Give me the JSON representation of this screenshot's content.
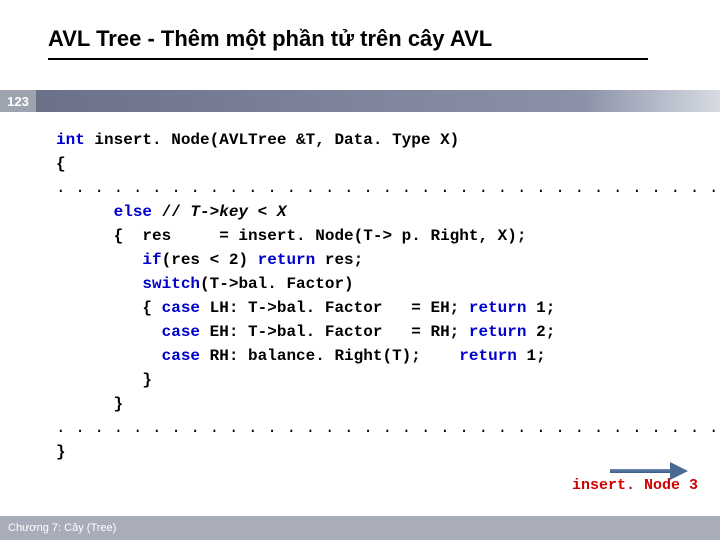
{
  "title": "AVL Tree - Thêm một phần tử trên cây AVL",
  "pageNumber": "123",
  "code": {
    "l1a": "int",
    "l1b": " insert. Node(AVLTree &T, Data. Type X)",
    "l2": "{",
    "l3": ". . . . . . . . . . . . . . . . . . . . . . . . . . . . . . . . . . . . . . . . . . . . . . . .",
    "l4a": "      ",
    "l4b": "else",
    "l4c": " // ",
    "l4d": "T->key < X",
    "l5a": "      {  res     = insert. Node(T-> p. Right, X);",
    "l6a": "         ",
    "l6b": "if",
    "l6c": "(res < 2) ",
    "l6d": "return",
    "l6e": " res;",
    "l7a": "         ",
    "l7b": "switch",
    "l7c": "(T->bal. Factor)",
    "l8a": "         { ",
    "l8b": "case",
    "l8c": " LH: T->bal. Factor   = EH; ",
    "l8d": "return",
    "l8e": " 1;",
    "l9a": "           ",
    "l9b": "case",
    "l9c": " EH: T->bal. Factor   = RH; ",
    "l9d": "return",
    "l9e": " 2;",
    "l10a": "           ",
    "l10b": "case",
    "l10c": " RH: balance. Right(T);    ",
    "l10d": "return",
    "l10e": " 1;",
    "l11": "         }",
    "l12": "      }",
    "l13": ". . . . . . . . . . . . . . . . . . . . . . . . . . . . . . . . . . . . . . . . . . . . . . . . .",
    "l14": "}"
  },
  "tag": "insert. Node 3",
  "footer": "Chương 7: Cây (Tree)"
}
